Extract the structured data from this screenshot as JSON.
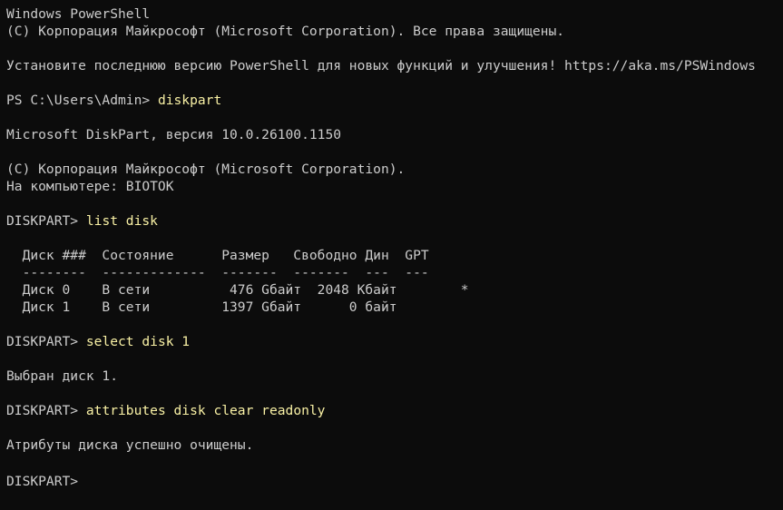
{
  "terminal": {
    "lines": [
      {
        "text": "Windows PowerShell"
      },
      {
        "text": "(C) Корпорация Майкрософт (Microsoft Corporation). Все права защищены."
      },
      {
        "text": ""
      },
      {
        "text": "Установите последнюю версию PowerShell для новых функций и улучшения! https://aka.ms/PSWindows"
      },
      {
        "text": ""
      },
      {
        "prompt": "PS C:\\Users\\Admin> ",
        "command": "diskpart"
      },
      {
        "text": ""
      },
      {
        "text": "Microsoft DiskPart, версия 10.0.26100.1150"
      },
      {
        "text": ""
      },
      {
        "text": "(C) Корпорация Майкрософт (Microsoft Corporation)."
      },
      {
        "text": "На компьютере: BIOTOK"
      },
      {
        "text": ""
      },
      {
        "prompt": "DISKPART> ",
        "command": "list disk"
      },
      {
        "text": ""
      },
      {
        "text": "  Диск ###  Состояние      Размер   Свободно Дин  GPT"
      },
      {
        "text": "  --------  -------------  -------  -------  ---  ---"
      },
      {
        "text": "  Диск 0    В сети          476 Gбайт  2048 Kбайт        *"
      },
      {
        "text": "  Диск 1    В сети         1397 Gбайт      0 байт"
      },
      {
        "text": ""
      },
      {
        "prompt": "DISKPART> ",
        "command": "select disk 1"
      },
      {
        "text": ""
      },
      {
        "text": "Выбран диск 1."
      },
      {
        "text": ""
      },
      {
        "prompt": "DISKPART> ",
        "command": "attributes disk clear readonly"
      },
      {
        "text": ""
      },
      {
        "text": "Атрибуты диска успешно очищены."
      },
      {
        "text": ""
      },
      {
        "prompt": "DISKPART> ",
        "command": ""
      }
    ]
  }
}
